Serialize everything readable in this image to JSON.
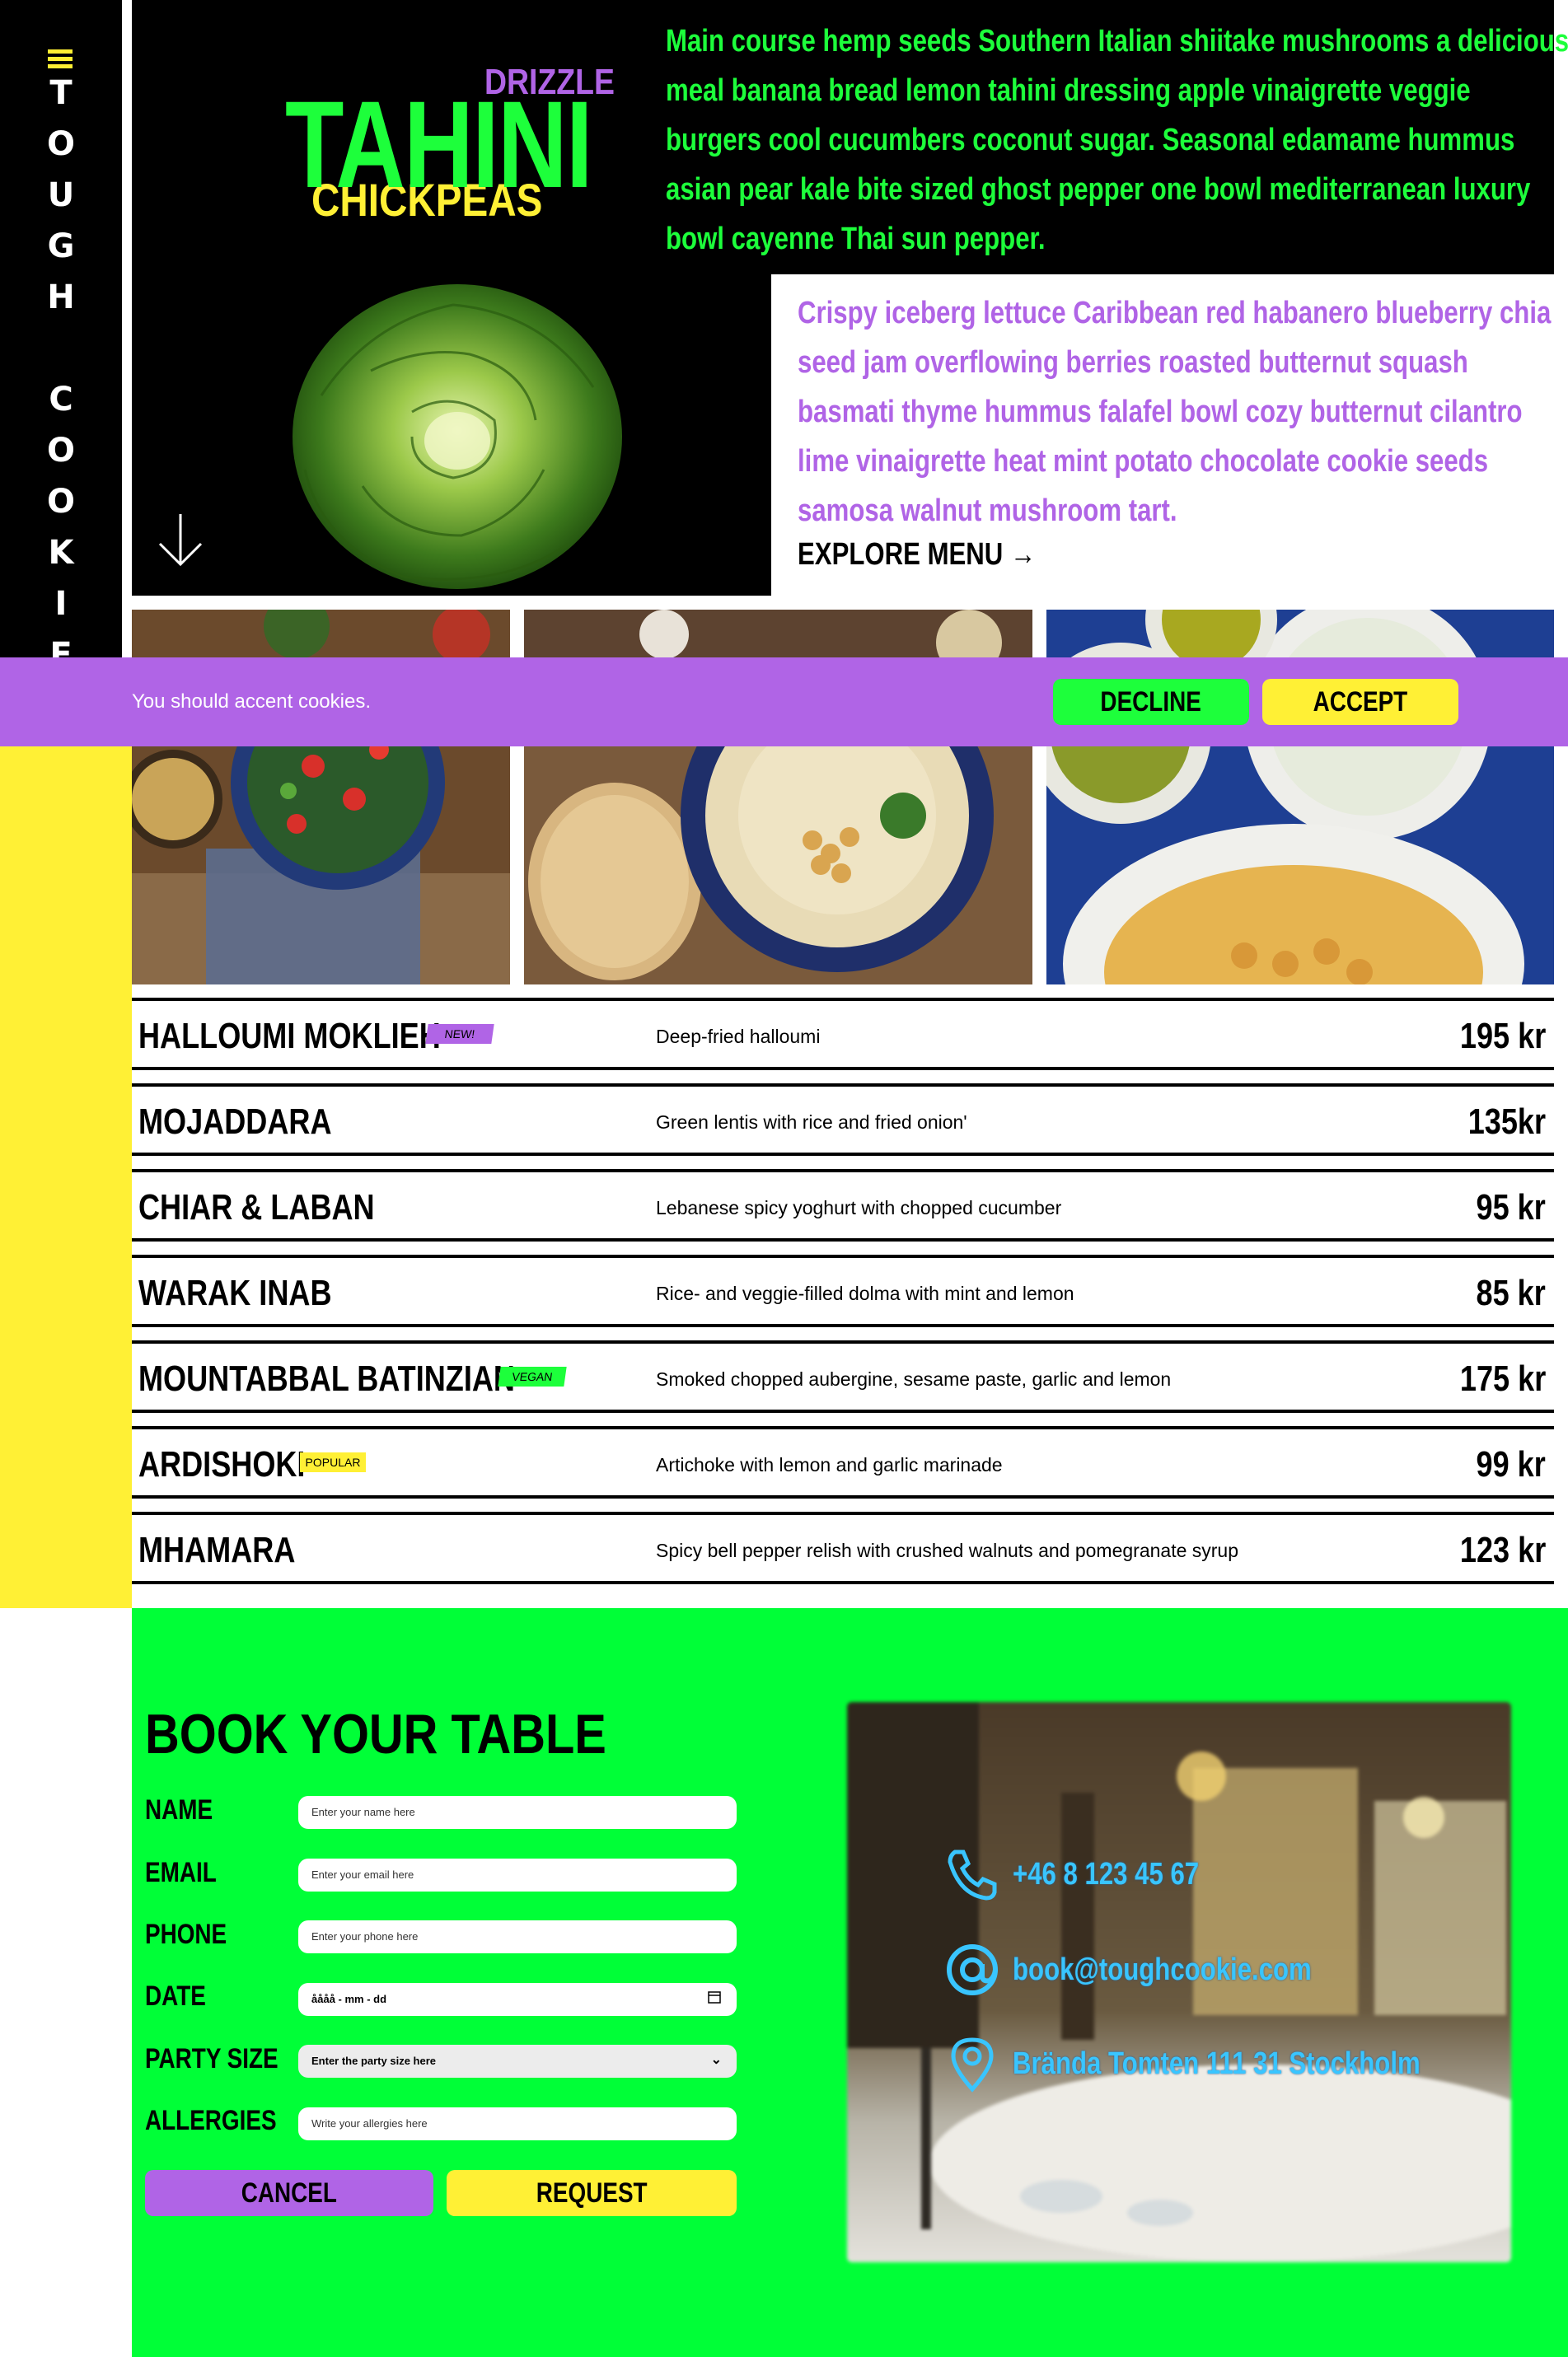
{
  "brand": {
    "vertical_letters": [
      "T",
      "O",
      "U",
      "G",
      "H",
      " ",
      "C",
      "O",
      "O",
      "K",
      "I",
      "E"
    ],
    "colors": {
      "green": "#1dff3b",
      "purple": "#b064e6",
      "yellow": "#fff035",
      "black": "#000000"
    }
  },
  "hero": {
    "title_drizzle": "DRIZZLE",
    "title_tahini": "TAHINI",
    "title_chickpeas": "CHICKPEAS",
    "green_lines": [
      "Main course hemp seeds Southern Italian shiitake mushrooms a delicious",
      "meal banana bread lemon tahini dressing apple vinaigrette veggie",
      "burgers cool cucumbers coconut sugar. Seasonal edamame hummus",
      "asian pear kale bite sized ghost pepper one bowl mediterranean luxury",
      "bowl cayenne Thai sun pepper."
    ],
    "purple_lines": [
      "Crispy iceberg lettuce Caribbean red habanero blueberry chia",
      "seed jam overflowing berries roasted butternut squash",
      "basmati thyme hummus falafel bowl cozy butternut cilantro",
      "lime vinaigrette heat mint potato chocolate cookie seeds",
      "samosa walnut mushroom tart."
    ],
    "explore_label": "EXPLORE MENU"
  },
  "cookie": {
    "text": "You should accent cookies.",
    "decline_label": "DECLINE",
    "accept_label": "ACCEPT"
  },
  "menu": [
    {
      "name": "HALLOUMI MOKLIEH",
      "badge": "NEW!",
      "desc": "Deep-fried halloumi",
      "price": "195 kr"
    },
    {
      "name": "MOJADDARA",
      "badge": "",
      "desc": "Green lentis with rice and fried onion'",
      "price": "135kr"
    },
    {
      "name": "CHIAR & LABAN",
      "badge": "",
      "desc": "Lebanese spicy yoghurt with chopped cucumber",
      "price": "95 kr"
    },
    {
      "name": "WARAK INAB",
      "badge": "",
      "desc": "Rice- and veggie-filled dolma with mint and lemon",
      "price": "85 kr"
    },
    {
      "name": "MOUNTABBAL BATINZIAN",
      "badge": "VEGAN",
      "desc": "Smoked chopped aubergine, sesame paste, garlic and lemon",
      "price": "175 kr"
    },
    {
      "name": "ARDISHOKI",
      "badge": "POPULAR",
      "desc": "Artichoke with lemon and garlic marinade",
      "price": "99 kr"
    },
    {
      "name": "MHAMARA",
      "badge": "",
      "desc": "Spicy bell pepper relish with crushed walnuts and pomegranate syrup",
      "price": "123 kr"
    }
  ],
  "booking": {
    "title": "BOOK YOUR TABLE",
    "fields": {
      "name": {
        "label": "NAME",
        "placeholder": "Enter your name here"
      },
      "email": {
        "label": "EMAIL",
        "placeholder": "Enter your email here"
      },
      "phone": {
        "label": "PHONE",
        "placeholder": "Enter your phone here"
      },
      "date": {
        "label": "DATE",
        "placeholder": "åååå - mm - dd"
      },
      "party": {
        "label": "PARTY SIZE",
        "placeholder": "Enter the party size here"
      },
      "allergies": {
        "label": "ALLERGIES",
        "placeholder": "Write your allergies here"
      }
    },
    "cancel_label": "CANCEL",
    "request_label": "REQUEST"
  },
  "contact": {
    "phone": "+46 8 123 45 67",
    "email": "book@toughcookie.com",
    "address": "Brända Tomten 111 31 Stockholm"
  }
}
